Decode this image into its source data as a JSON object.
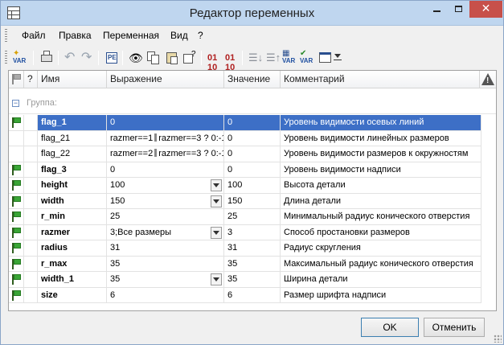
{
  "window": {
    "title": "Редактор переменных"
  },
  "menu": [
    "Файл",
    "Правка",
    "Переменная",
    "Вид",
    "?"
  ],
  "toolbar_icons": [
    "add-variable-icon",
    "print-icon",
    "undo-icon",
    "redo-icon",
    "parameters-icon",
    "find-icon",
    "copy-icon",
    "paste-icon",
    "clear-icon",
    "export-icon",
    "import-icon",
    "move-down-icon",
    "move-up-icon",
    "external-variable-icon",
    "check-variable-icon",
    "view-icon"
  ],
  "header": {
    "question": "?",
    "name": "Имя",
    "expression": "Выражение",
    "value": "Значение",
    "comment": "Комментарий"
  },
  "group_label": "Группа:",
  "rows": [
    {
      "flag": true,
      "name": "flag_1",
      "bold": true,
      "expr": "0",
      "value": "0",
      "comment": "Уровень видимости осевых линий",
      "selected": true
    },
    {
      "flag": false,
      "name": "flag_21",
      "bold": false,
      "expr_parts": [
        "razmer==1",
        "razmer==3 ? 0:-1"
      ],
      "value": "0",
      "comment": "Уровень видимости линейных размеров"
    },
    {
      "flag": false,
      "name": "flag_22",
      "bold": false,
      "expr_parts": [
        "razmer==2",
        "razmer==3 ? 0:-1"
      ],
      "value": "0",
      "comment": "Уровень видимости размеров к окружностям"
    },
    {
      "flag": true,
      "name": "flag_3",
      "bold": true,
      "expr": "0",
      "value": "0",
      "comment": "Уровень видимости надписи"
    },
    {
      "flag": true,
      "name": "height",
      "bold": true,
      "expr": "100",
      "value": "100",
      "comment": "Высота детали",
      "dropdown": true
    },
    {
      "flag": true,
      "name": "width",
      "bold": true,
      "expr": "150",
      "value": "150",
      "comment": "Длина детали",
      "dropdown": true
    },
    {
      "flag": true,
      "name": "r_min",
      "bold": true,
      "expr": "25",
      "value": "25",
      "comment": "Минимальный радиус конического отверстия"
    },
    {
      "flag": true,
      "name": "razmer",
      "bold": true,
      "expr": "3;Все размеры",
      "value": "3",
      "comment": "Способ простановки размеров",
      "dropdown": true
    },
    {
      "flag": true,
      "name": "radius",
      "bold": true,
      "expr": "31",
      "value": "31",
      "comment": "Радиус скругления"
    },
    {
      "flag": true,
      "name": "r_max",
      "bold": true,
      "expr": "35",
      "value": "35",
      "comment": "Максимальный радиус конического отверстия"
    },
    {
      "flag": true,
      "name": "width_1",
      "bold": true,
      "expr": "35",
      "value": "35",
      "comment": "Ширина детали",
      "dropdown": true
    },
    {
      "flag": true,
      "name": "size",
      "bold": true,
      "expr": "6",
      "value": "6",
      "comment": "Размер шрифта надписи"
    }
  ],
  "buttons": {
    "ok": "OK",
    "cancel": "Отменить"
  },
  "colors": {
    "selection": "#3d6fc6",
    "flag": "#3aa536",
    "close": "#c7504a"
  }
}
